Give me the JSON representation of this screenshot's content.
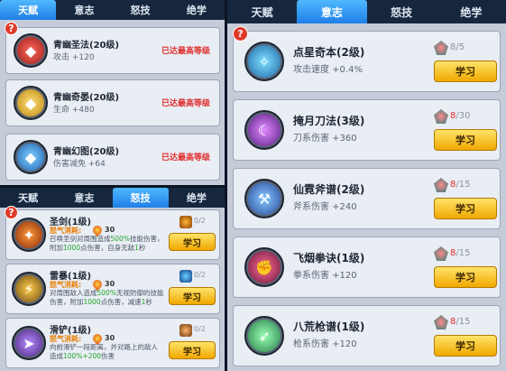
{
  "tabs": [
    "天赋",
    "意志",
    "怒技",
    "绝学"
  ],
  "help": "?",
  "talents": [
    {
      "name": "青幽圣法(20级)",
      "desc": "攻击 +120",
      "status": "已达最高等级"
    },
    {
      "name": "青幽奇晏(20级)",
      "desc": "生命 +480",
      "status": "已达最高等级"
    },
    {
      "name": "青幽幻图(20级)",
      "desc": "伤害减免 +64",
      "status": "已达最高等级"
    }
  ],
  "rage_skills": [
    {
      "name": "圣剑(1级)",
      "rage_label": "怒气消耗:",
      "rage": "30",
      "cost": "0/2",
      "desc": [
        "召唤圣剑对周围造成",
        "500%",
        "技能伤害",
        "，附加",
        "1000",
        "点伤害，自身无敌",
        "1",
        "秒"
      ],
      "button": "学习"
    },
    {
      "name": "雷暴(1级)",
      "rage_label": "怒气消耗:",
      "rage": "30",
      "cost": "0/2",
      "desc": [
        "对周围敌人造成",
        "500%",
        "无视防御的技能伤害",
        "，附加",
        "1000",
        "点伤害，减速",
        "1",
        "秒"
      ],
      "button": "学习"
    },
    {
      "name": "滑铲(1级)",
      "rage_label": "怒气消耗:",
      "rage": "30",
      "cost": "0/2",
      "desc": [
        "向前滑铲一段距离，并对路上的敌人",
        "",
        "造成",
        "100%+200",
        "伤害"
      ],
      "button": "学习"
    }
  ],
  "will_skills": [
    {
      "name": "点星奇本(2级)",
      "desc": "攻击速度 +0.4%",
      "cost_have": "8",
      "cost_need": "5",
      "have_color": "#8a93a2",
      "button": "学习"
    },
    {
      "name": "掩月刀法(3级)",
      "desc": "刀系伤害 +360",
      "cost_have": "8",
      "cost_need": "30",
      "have_color": "#e02d2d",
      "button": "学习"
    },
    {
      "name": "仙霓斧谱(2级)",
      "desc": "斧系伤害 +240",
      "cost_have": "8",
      "cost_need": "15",
      "have_color": "#e02d2d",
      "button": "学习"
    },
    {
      "name": "飞烟拳诀(1级)",
      "desc": "拳系伤害 +120",
      "cost_have": "8",
      "cost_need": "15",
      "have_color": "#e02d2d",
      "button": "学习"
    },
    {
      "name": "八荒枪谱(1级)",
      "desc": "枪系伤害 +120",
      "cost_have": "8",
      "cost_need": "15",
      "have_color": "#e02d2d",
      "button": "学习"
    }
  ]
}
